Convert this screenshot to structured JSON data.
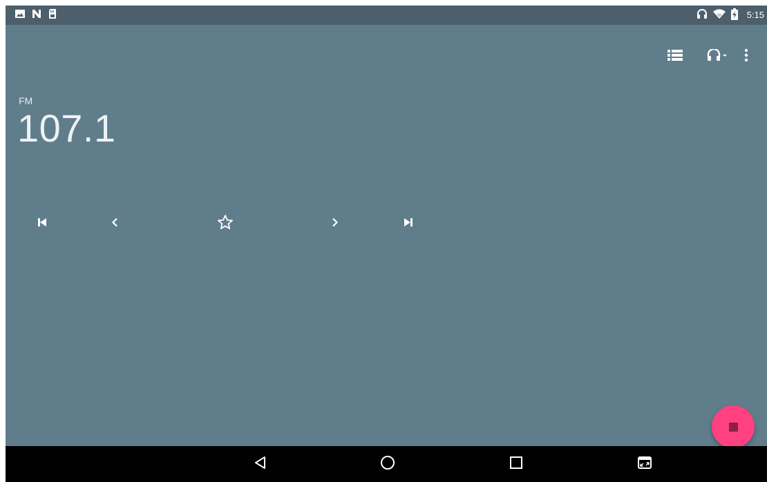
{
  "status_bar": {
    "time": "5:15",
    "left_icons": [
      "image-icon",
      "n-notification-icon",
      "sd-card-icon"
    ],
    "right_icons": [
      "headset-icon",
      "wifi-icon",
      "battery-charging-icon"
    ]
  },
  "toolbar": {
    "icons": [
      "station-list-icon",
      "headset-output-icon",
      "overflow-menu-icon"
    ]
  },
  "radio": {
    "band": "FM",
    "frequency": "107.1"
  },
  "controls": [
    "skip-previous-icon",
    "seek-back-icon",
    "favorite-star-icon",
    "seek-forward-icon",
    "skip-next-icon"
  ],
  "fab": {
    "icon": "stop-icon",
    "color": "#ff4081"
  },
  "nav_bar": [
    "back-icon",
    "home-icon",
    "recents-icon",
    "picture-in-picture-icon"
  ],
  "colors": {
    "app_background": "#607d8b",
    "status_bar": "#4d5f6c",
    "nav_bar": "#000000"
  }
}
